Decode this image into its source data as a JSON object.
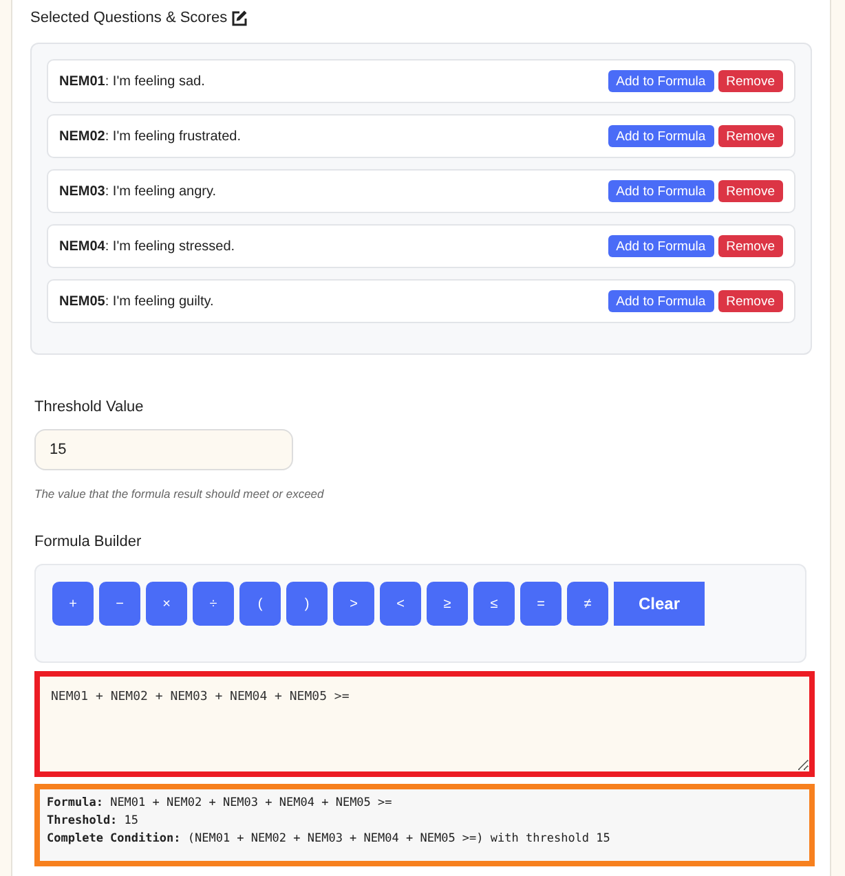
{
  "questions_section": {
    "title": "Selected Questions & Scores",
    "items": [
      {
        "text": "**NEM01**: I'm feeling sad.",
        "add_label": "Add to Formula",
        "remove_label": "Remove"
      },
      {
        "text": "**NEM02**: I'm feeling frustrated.",
        "add_label": "Add to Formula",
        "remove_label": "Remove"
      },
      {
        "text": "**NEM03**: I'm feeling angry.",
        "add_label": "Add to Formula",
        "remove_label": "Remove"
      },
      {
        "text": "**NEM04**: I'm feeling stressed.",
        "add_label": "Add to Formula",
        "remove_label": "Remove"
      },
      {
        "text": "**NEM05**: I'm feeling guilty.",
        "add_label": "Add to Formula",
        "remove_label": "Remove"
      }
    ]
  },
  "threshold": {
    "label": "Threshold Value",
    "value": "15",
    "hint": "The value that the formula result should meet or exceed"
  },
  "formula_builder": {
    "label": "Formula Builder",
    "operators": [
      "+",
      "−",
      "×",
      "÷",
      "(",
      ")",
      ">",
      "<",
      "≥",
      "≤",
      "=",
      "≠"
    ],
    "clear_label": "Clear",
    "formula": "NEM01 + NEM02 + NEM03 + NEM04 + NEM05 >="
  },
  "summary": {
    "lines": [
      "**Formula:** NEM01 + NEM02 + NEM03 + NEM04 + NEM05 >=",
      "**Threshold:** 15",
      "**Complete Condition:** (NEM01 + NEM02 + NEM03 + NEM04 + NEM05 >=) with threshold 15"
    ]
  }
}
